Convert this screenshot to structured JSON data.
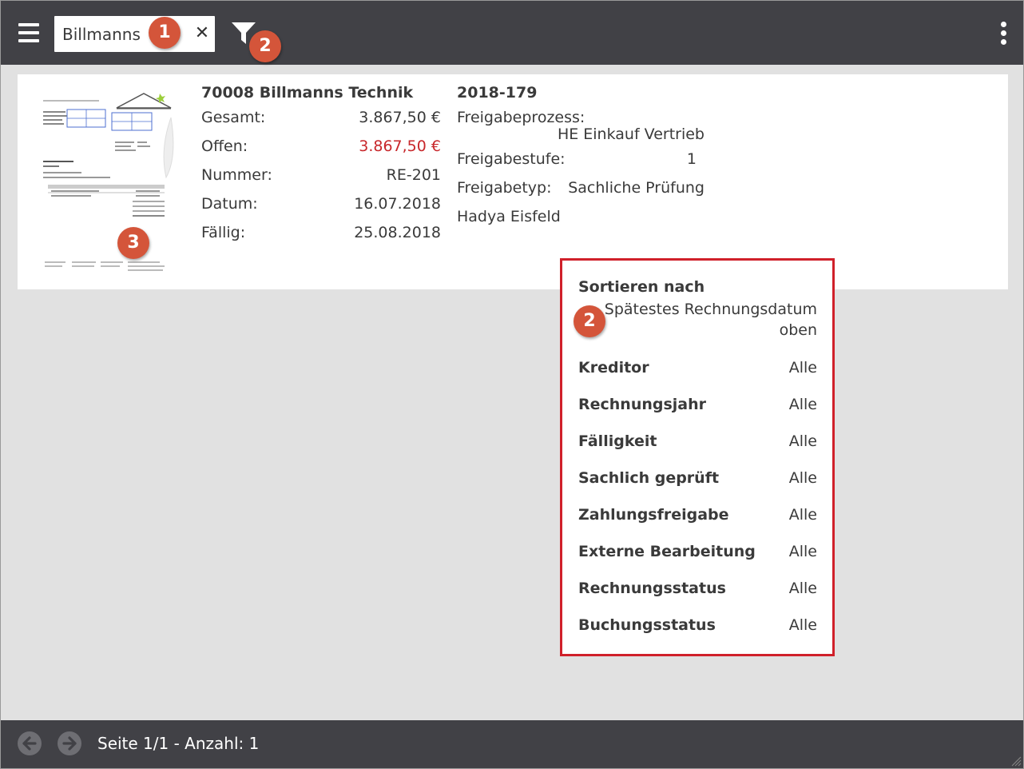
{
  "search": {
    "value": "Billmanns"
  },
  "badges": {
    "search": "1",
    "filter": "2",
    "thumbnail": "3",
    "panel": "2"
  },
  "invoice": {
    "title": "70008 Billmanns Technik",
    "rows": [
      {
        "label": "Gesamt:",
        "value": "3.867,50 €"
      },
      {
        "label": "Offen:",
        "value": "3.867,50 €"
      },
      {
        "label": "Nummer:",
        "value": "RE-201"
      },
      {
        "label": "Datum:",
        "value": "16.07.2018"
      },
      {
        "label": "Fällig:",
        "value": "25.08.2018"
      }
    ],
    "ref_title": "2018-179",
    "approval_process_label": "Freigabeprozess:",
    "approval_process_value": "HE Einkauf Vertrieb",
    "approval_level_label": "Freigabestufe:",
    "approval_level_value": "1",
    "approval_type_label": "Freigabetyp:",
    "approval_type_value": "Sachliche Prüfung",
    "approver": "Hadya Eisfeld"
  },
  "filter_panel": {
    "sort_label": "Sortieren nach",
    "sort_value": "Spätestes Rechnungsdatum oben",
    "filters": [
      {
        "label": "Kreditor",
        "value": "Alle"
      },
      {
        "label": "Rechnungsjahr",
        "value": "Alle"
      },
      {
        "label": "Fälligkeit",
        "value": "Alle"
      },
      {
        "label": "Sachlich geprüft",
        "value": "Alle"
      },
      {
        "label": "Zahlungsfreigabe",
        "value": "Alle"
      },
      {
        "label": "Externe Bearbeitung",
        "value": "Alle"
      },
      {
        "label": "Rechnungsstatus",
        "value": "Alle"
      },
      {
        "label": "Buchungsstatus",
        "value": "Alle"
      }
    ]
  },
  "pagination": {
    "info": "Seite 1/1 - Anzahl: 1"
  },
  "colors": {
    "bar": "#414146",
    "background": "#e1e1e1",
    "badge": "#d4553a",
    "open_amount": "#c8272b",
    "panel_border": "#d0202a"
  }
}
